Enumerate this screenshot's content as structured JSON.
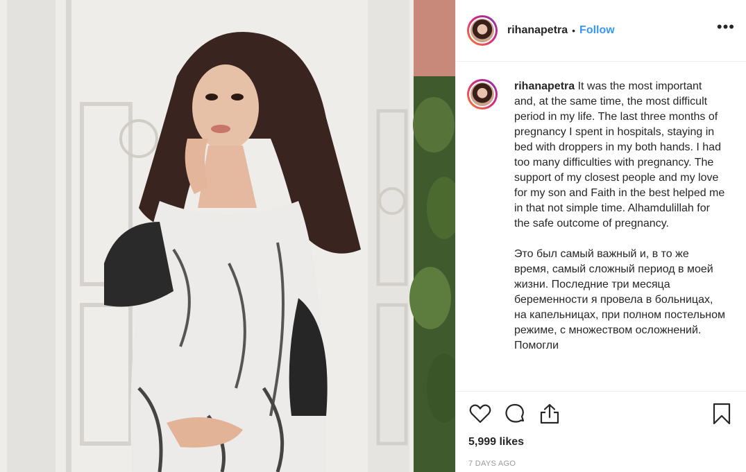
{
  "post": {
    "username": "rihanapetra",
    "separator": "•",
    "follow_label": "Follow",
    "more_label": "•••",
    "caption": {
      "username": "rihanapetra",
      "text": " It was the most important and, at the same time, the most difficult period in my life. The last three months of pregnancy I spent in hospitals, staying in bed with droppers in my both hands. I had too many difficulties with pregnancy. The support of my closest people and my love for my son and Faith in the best helped me in that not simple time. Alhamdulillah for the safe outcome of pregnancy.\n\nЭто был самый важный и, в то же время, самый сложный период в моей жизни. Последние три месяца беременности я провела в больницах, на капельницах, при полном постельном режиме, с множеством осложнений. Помогли"
    },
    "likes": "5,999 likes",
    "date": "7 DAYS AGO"
  },
  "icons": {
    "like": "heart-icon",
    "comment": "comment-icon",
    "share": "share-icon",
    "save": "bookmark-icon",
    "more": "more-options-icon"
  },
  "colors": {
    "link": "#3897f0",
    "text": "#262626",
    "muted": "#999999",
    "border": "#efefef"
  }
}
